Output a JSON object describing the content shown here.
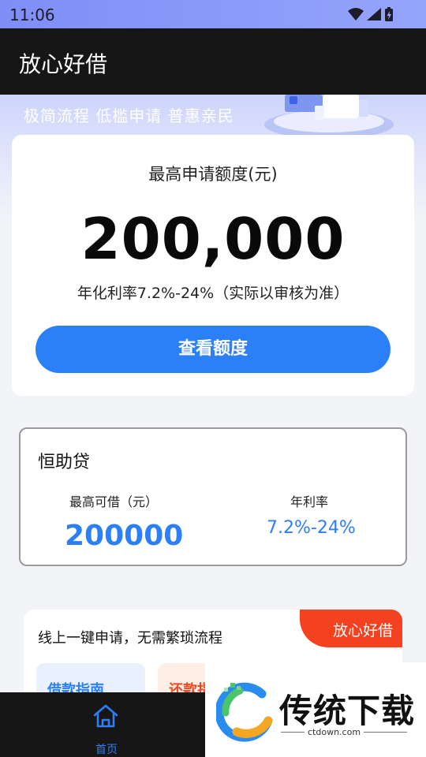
{
  "status_bar": {
    "time": "11:06",
    "icons": [
      "wifi-icon",
      "signal-icon",
      "battery-charging-icon"
    ]
  },
  "app_bar": {
    "title": "放心好借"
  },
  "banner": {
    "slogan": "极简流程 低槛申请 普惠亲民"
  },
  "quota_card": {
    "label": "最高申请额度(元)",
    "amount": "200,000",
    "rate_text": "年化利率7.2%-24%（实际以审核为准）",
    "button_label": "查看额度"
  },
  "product_card": {
    "name": "恒助贷",
    "max_label": "最高可借（元）",
    "max_value": "200000",
    "rate_label": "年利率",
    "rate_value": "7.2%-24%"
  },
  "promo_card": {
    "corner_label": "放心好借",
    "text": "线上一键申请，无需繁琐流程",
    "guide_label": "借款指南",
    "repay_label": "还款指"
  },
  "bottom_nav": {
    "items": [
      {
        "label": "首页",
        "icon": "home-icon",
        "active": true
      }
    ]
  },
  "watermark": {
    "title": "传统下载",
    "url": "ctdown.com"
  },
  "colors": {
    "accent": "#2b7ff7",
    "promo_orange": "#f4411f",
    "app_bar": "#161616",
    "status_bar": "#7f8ef7"
  }
}
